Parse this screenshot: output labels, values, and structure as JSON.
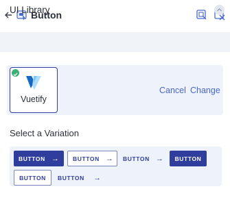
{
  "header": {
    "back_icon": "back-arrow-icon",
    "app_icon": "button-component-icon",
    "title": "Button",
    "action_icons": [
      "preview-icon",
      "close-panel-icon"
    ]
  },
  "section": {
    "title": "UI Library",
    "collapse_icon": "chevron-up-icon"
  },
  "library": {
    "name": "Vuetify",
    "selected_icon": "check-circle-icon",
    "logo_icon": "vuetify-logo-icon",
    "cancel_label": "Cancel",
    "change_label": "Change"
  },
  "variations": {
    "title": "Select a Variation",
    "items": [
      {
        "label": "BUTTON",
        "arrow": "→"
      },
      {
        "label": "BUTTON",
        "arrow": "→"
      },
      {
        "label": "BUTTON",
        "arrow": "→"
      },
      {
        "label": "BUTTON"
      },
      {
        "label": "BUTTON"
      },
      {
        "label": "BUTTON"
      },
      {
        "arrow": "→"
      }
    ]
  },
  "colors": {
    "accent": "#2f3d9c",
    "link": "#4a67c9",
    "panel_bg": "#eef2fa",
    "section_bg": "#f0f3f8",
    "success": "#3bb273"
  }
}
